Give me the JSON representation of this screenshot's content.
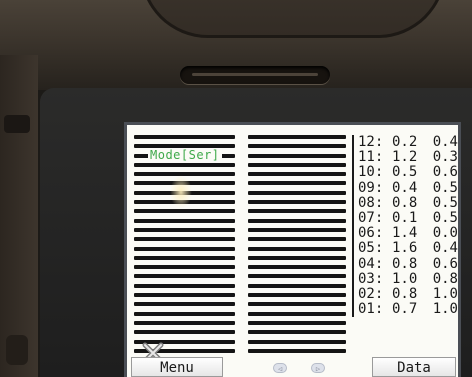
{
  "screen": {
    "mode_label": "Mode[Ser]"
  },
  "readings": [
    {
      "index": "12:",
      "a": "0.2",
      "b": "0.4"
    },
    {
      "index": "11:",
      "a": "1.2",
      "b": "0.3"
    },
    {
      "index": "10:",
      "a": "0.5",
      "b": "0.6"
    },
    {
      "index": "09:",
      "a": "0.4",
      "b": "0.5"
    },
    {
      "index": "08:",
      "a": "0.8",
      "b": "0.5"
    },
    {
      "index": "07:",
      "a": "0.1",
      "b": "0.5"
    },
    {
      "index": "06:",
      "a": "1.4",
      "b": "0.0"
    },
    {
      "index": "05:",
      "a": "1.6",
      "b": "0.4"
    },
    {
      "index": "04:",
      "a": "0.8",
      "b": "0.6"
    },
    {
      "index": "03:",
      "a": "1.0",
      "b": "0.8"
    },
    {
      "index": "02:",
      "a": "0.8",
      "b": "1.0"
    },
    {
      "index": "01:",
      "a": "0.7",
      "b": "1.0"
    }
  ],
  "softkeys": {
    "menu_label": "Menu",
    "data_label": "Data",
    "prev_icon": "left-arrow-icon",
    "next_icon": "right-arrow-icon"
  },
  "colors": {
    "mode_label": "#3fa94a",
    "trace": "#141414",
    "screen_bg": "#fbfbf6"
  }
}
